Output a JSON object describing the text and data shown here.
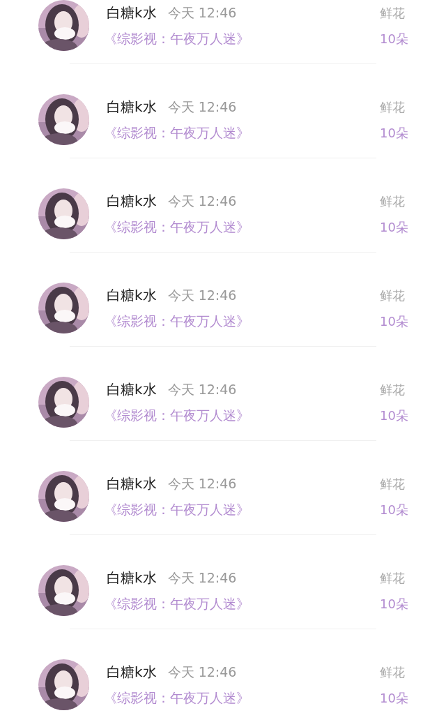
{
  "rows": [
    {
      "name": "白糖k水",
      "time": "今天 12:46",
      "book": "《综影视：午夜万人迷》",
      "gift_label": "鲜花",
      "gift_count": "10朵"
    },
    {
      "name": "白糖k水",
      "time": "今天 12:46",
      "book": "《综影视：午夜万人迷》",
      "gift_label": "鲜花",
      "gift_count": "10朵"
    },
    {
      "name": "白糖k水",
      "time": "今天 12:46",
      "book": "《综影视：午夜万人迷》",
      "gift_label": "鲜花",
      "gift_count": "10朵"
    },
    {
      "name": "白糖k水",
      "time": "今天 12:46",
      "book": "《综影视：午夜万人迷》",
      "gift_label": "鲜花",
      "gift_count": "10朵"
    },
    {
      "name": "白糖k水",
      "time": "今天 12:46",
      "book": "《综影视：午夜万人迷》",
      "gift_label": "鲜花",
      "gift_count": "10朵"
    },
    {
      "name": "白糖k水",
      "time": "今天 12:46",
      "book": "《综影视：午夜万人迷》",
      "gift_label": "鲜花",
      "gift_count": "10朵"
    },
    {
      "name": "白糖k水",
      "time": "今天 12:46",
      "book": "《综影视：午夜万人迷》",
      "gift_label": "鲜花",
      "gift_count": "10朵"
    },
    {
      "name": "白糖k水",
      "time": "今天 12:46",
      "book": "《综影视：午夜万人迷》",
      "gift_label": "鲜花",
      "gift_count": "10朵"
    }
  ]
}
